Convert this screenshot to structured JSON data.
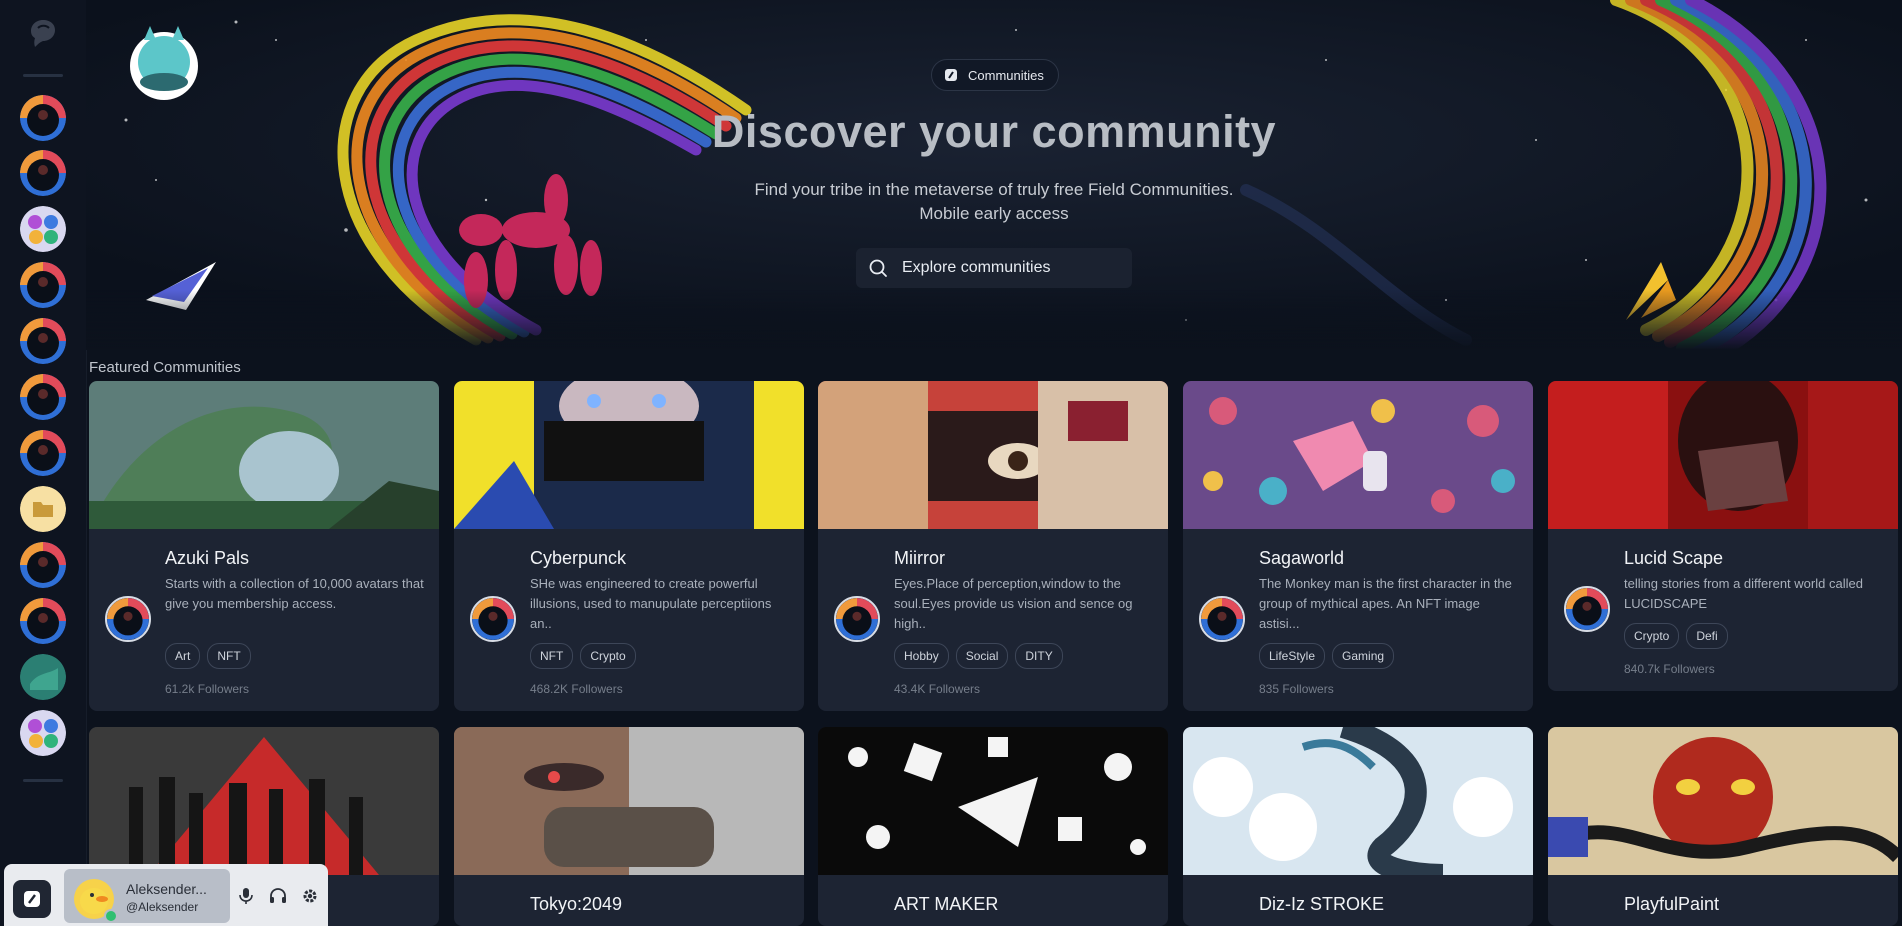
{
  "sidebar": {
    "items": [
      {
        "name": "community-avatar-1",
        "type": "bot"
      },
      {
        "name": "community-avatar-2",
        "type": "bot"
      },
      {
        "name": "community-avatar-3",
        "type": "swirl"
      },
      {
        "name": "community-avatar-4",
        "type": "bot"
      },
      {
        "name": "community-avatar-5",
        "type": "bot"
      },
      {
        "name": "community-avatar-6",
        "type": "bot"
      },
      {
        "name": "community-avatar-7",
        "type": "bot"
      },
      {
        "name": "folder",
        "type": "folder"
      },
      {
        "name": "community-avatar-8",
        "type": "bot"
      },
      {
        "name": "community-avatar-9",
        "type": "bot"
      },
      {
        "name": "community-avatar-10",
        "type": "teal"
      },
      {
        "name": "community-avatar-11",
        "type": "swirl"
      }
    ]
  },
  "hero": {
    "pill_label": "Communities",
    "title": "Discover your community",
    "subtitle_line1": "Find your tribe in the metaverse of truly free Field Communities.",
    "subtitle_line2": "Mobile early access",
    "search_placeholder": "Explore communities"
  },
  "featured": {
    "title": "Featured Communities",
    "cards": [
      {
        "name": "Azuki Pals",
        "desc": "Starts with a collection of 10,000 avatars that give you membership access.",
        "tags": [
          "Art",
          "NFT"
        ],
        "followers": "61.2k Followers"
      },
      {
        "name": "Cyberpunck",
        "desc": "SHe was engineered to create powerful illusions, used to manupulate perceptiions an..",
        "tags": [
          "NFT",
          "Crypto"
        ],
        "followers": "468.2K Followers"
      },
      {
        "name": "Miirror",
        "desc": "Eyes.Place of perception,window to the soul.Eyes provide us vision and sence og high..",
        "tags": [
          "Hobby",
          "Social",
          "DITY"
        ],
        "followers": "43.4K Followers"
      },
      {
        "name": "Sagaworld",
        "desc": "The Monkey man is the first character in the group of mythical apes. An NFT image astisi...",
        "tags": [
          "LifeStyle",
          "Gaming"
        ],
        "followers": "835 Followers"
      },
      {
        "name": "Lucid Scape",
        "desc": "telling stories from a different world called LUCIDSCAPE",
        "tags": [
          "Crypto",
          "Defi"
        ],
        "followers": "840.7k Followers"
      }
    ],
    "row2": [
      {
        "name": ""
      },
      {
        "name": "Tokyo:2049"
      },
      {
        "name": "ART MAKER"
      },
      {
        "name": "Diz-Iz STROKE"
      },
      {
        "name": "PlayfulPaint"
      }
    ]
  },
  "user": {
    "name": "Aleksender...",
    "handle": "@Aleksender"
  },
  "colors": {
    "background": "#0c121d",
    "card": "#1d2433",
    "online": "#2fbf71"
  }
}
